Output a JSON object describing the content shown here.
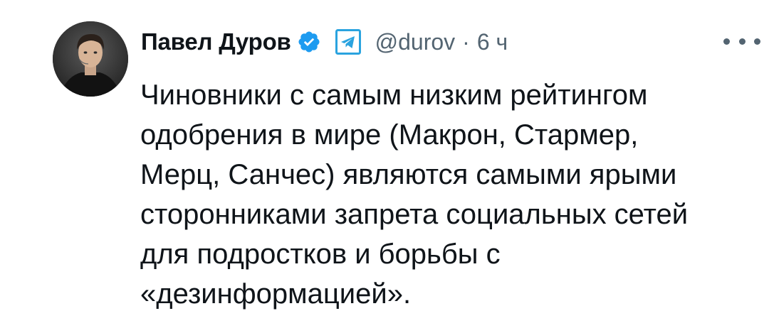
{
  "tweet": {
    "author_name": "Павел Дуров",
    "handle": "@durov",
    "separator": "·",
    "time": "6 ч",
    "text_lines": [
      "Чиновники с самым низким рейтингом",
      "одобрения в мире (Макрон, Стармер,",
      "Мерц, Санчес) являются самыми ярыми",
      "сторонниками запрета социальных сетей",
      "для подростков и борьбы с",
      "«дезинформацией»."
    ]
  },
  "icons": {
    "verified": "verified-badge-icon",
    "telegram": "telegram-icon",
    "more": "more-options-icon"
  },
  "colors": {
    "verified_blue": "#1d9bf0",
    "telegram_blue": "#2aa3df",
    "secondary_text": "#536471",
    "primary_text": "#0f1419"
  }
}
